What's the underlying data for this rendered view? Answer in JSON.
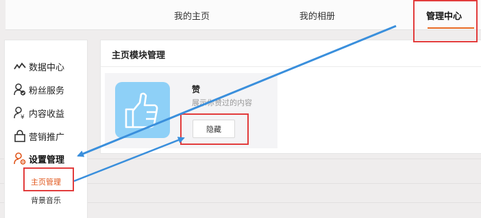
{
  "topnav": {
    "tabs": [
      {
        "label": "我的主页"
      },
      {
        "label": "我的相册"
      },
      {
        "label": "管理中心"
      }
    ]
  },
  "sidebar": {
    "items": [
      {
        "label": "数据中心",
        "icon": "chart-line-icon"
      },
      {
        "label": "粉丝服务",
        "icon": "user-check-icon"
      },
      {
        "label": "内容收益",
        "icon": "user-yen-icon"
      },
      {
        "label": "营销推广",
        "icon": "bag-icon"
      },
      {
        "label": "设置管理",
        "icon": "user-gear-icon"
      }
    ],
    "sub_items": [
      {
        "label": "主页管理"
      },
      {
        "label": "背景音乐"
      }
    ]
  },
  "main": {
    "title": "主页模块管理",
    "card": {
      "title": "赞",
      "description": "展示你赞过的内容",
      "button": "隐藏",
      "icon": "thumbs-up-icon"
    }
  },
  "colors": {
    "accent": "#e86a24",
    "highlight": "#e23b3b",
    "arrow": "#3a8fdc",
    "icon_bg": "#8ed0f7"
  }
}
